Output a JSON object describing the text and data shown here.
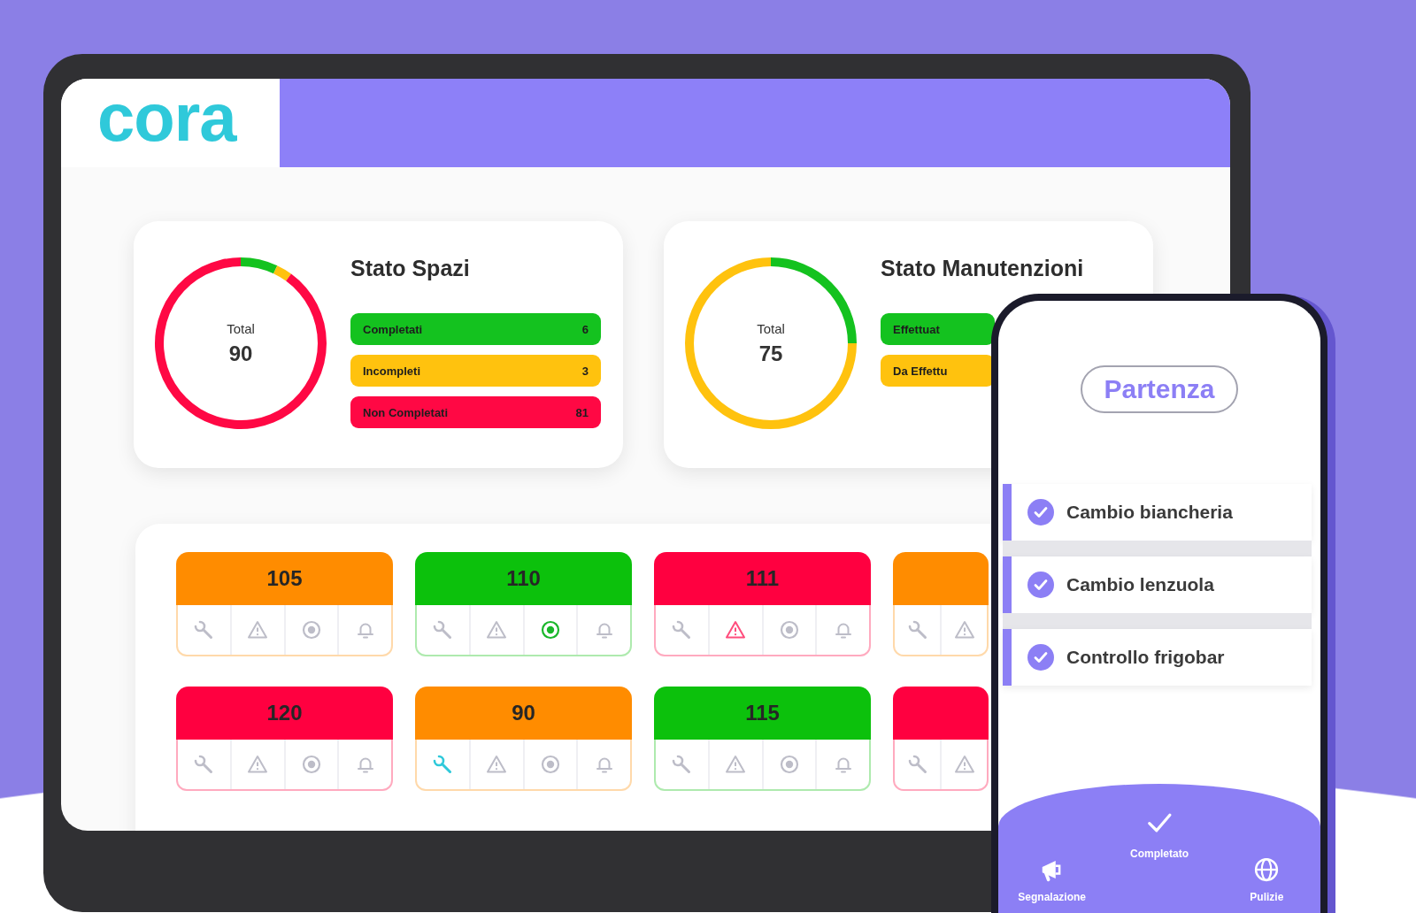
{
  "header": {
    "logo": "cora"
  },
  "cards": [
    {
      "title": "Stato Spazi",
      "center_label": "Total",
      "center_value": "90",
      "legend": [
        {
          "label": "Completati",
          "count": "6",
          "color": "#14c21f"
        },
        {
          "label": "Incompleti",
          "count": "3",
          "color": "#ffc20e"
        },
        {
          "label": "Non Completati",
          "count": "81",
          "color": "#ff0844"
        }
      ],
      "chart_data": {
        "type": "donut",
        "values": [
          7,
          3,
          90
        ]
      }
    },
    {
      "title": "Stato Manutenzioni",
      "center_label": "Total",
      "center_value": "75",
      "legend": [
        {
          "label": "Effettuat",
          "color": "#14c21f"
        },
        {
          "label": "Da Effettu",
          "color": "#ffc20e"
        }
      ],
      "chart_data": {
        "type": "donut",
        "values": [
          25,
          75
        ]
      }
    }
  ],
  "tiles": [
    {
      "number": "105",
      "color": "#ff8c00",
      "icons": [
        {
          "kind": "wrench",
          "active": false
        },
        {
          "kind": "warning",
          "active": false
        },
        {
          "kind": "ring",
          "active": false
        },
        {
          "kind": "bell",
          "active": false
        }
      ]
    },
    {
      "number": "110",
      "color": "#0cc10c",
      "icons": [
        {
          "kind": "wrench",
          "active": false
        },
        {
          "kind": "warning",
          "active": false
        },
        {
          "kind": "ring",
          "active": true
        },
        {
          "kind": "bell",
          "active": false
        }
      ]
    },
    {
      "number": "111",
      "color": "#ff0040",
      "icons": [
        {
          "kind": "wrench",
          "active": false
        },
        {
          "kind": "warning",
          "active": true
        },
        {
          "kind": "ring",
          "active": false
        },
        {
          "kind": "bell",
          "active": false
        }
      ]
    },
    {
      "color": "#ff8c00",
      "icons": [
        {
          "kind": "wrench",
          "active": false
        },
        {
          "kind": "warning",
          "active": false
        }
      ]
    },
    {
      "number": "120",
      "color": "#ff0040",
      "icons": [
        {
          "kind": "wrench",
          "active": false
        },
        {
          "kind": "warning",
          "active": false
        },
        {
          "kind": "ring",
          "active": false
        },
        {
          "kind": "bell",
          "active": false
        }
      ]
    },
    {
      "number": "90",
      "color": "#ff8c00",
      "icons": [
        {
          "kind": "wrench",
          "active": true
        },
        {
          "kind": "warning",
          "active": false
        },
        {
          "kind": "ring",
          "active": false
        },
        {
          "kind": "bell",
          "active": false
        }
      ]
    },
    {
      "number": "115",
      "color": "#0cc10c",
      "icons": [
        {
          "kind": "wrench",
          "active": false
        },
        {
          "kind": "warning",
          "active": false
        },
        {
          "kind": "ring",
          "active": false
        },
        {
          "kind": "bell",
          "active": false
        }
      ]
    },
    {
      "color": "#ff0040",
      "icons": [
        {
          "kind": "wrench",
          "active": false
        },
        {
          "kind": "warning",
          "active": false
        }
      ]
    }
  ],
  "phone": {
    "status_button": "Partenza",
    "tasks": [
      {
        "label": "Cambio biancheria",
        "checked": true
      },
      {
        "label": "Cambio lenzuola",
        "checked": true
      },
      {
        "label": "Controllo frigobar",
        "checked": true
      }
    ],
    "nav": [
      {
        "kind": "megaphone",
        "label": "Segnalazione"
      },
      {
        "kind": "check",
        "label": "Completato"
      },
      {
        "kind": "globe",
        "label": "Pulizie"
      }
    ]
  }
}
